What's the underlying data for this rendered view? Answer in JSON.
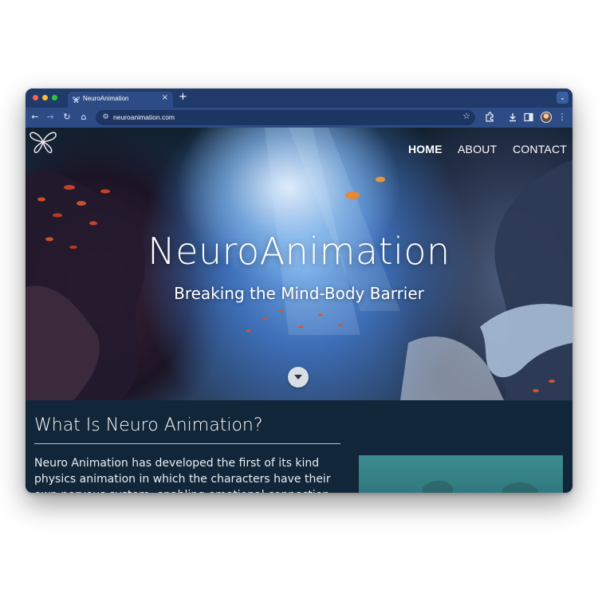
{
  "browser": {
    "tab_title": "NeuroAnimation",
    "tab_close_icon": "close-icon",
    "new_tab_label": "+",
    "url": "neuroanimation.com",
    "toolbar_icons": [
      "back-icon",
      "forward-icon",
      "reload-icon",
      "home-icon",
      "site-info-icon",
      "bookmark-star-icon",
      "extensions-icon",
      "downloads-icon",
      "side-panel-icon",
      "profile-avatar",
      "more-menu-icon"
    ]
  },
  "site": {
    "nav": {
      "home": "HOME",
      "about": "ABOUT",
      "contact": "CONTACT"
    },
    "hero": {
      "title": "NeuroAnimation",
      "subtitle": "Breaking the Mind-Body Barrier"
    },
    "section": {
      "heading": "What Is Neuro Animation?",
      "body": "Neuro Animation has developed the first of its kind physics animation in which the characters have their own nervous system, enabling emotional connection"
    }
  },
  "colors": {
    "tab_bar": "#203b6a",
    "toolbar": "#2d4c86",
    "section_bg": "#112638",
    "preview_teal": "#3b8c91"
  }
}
